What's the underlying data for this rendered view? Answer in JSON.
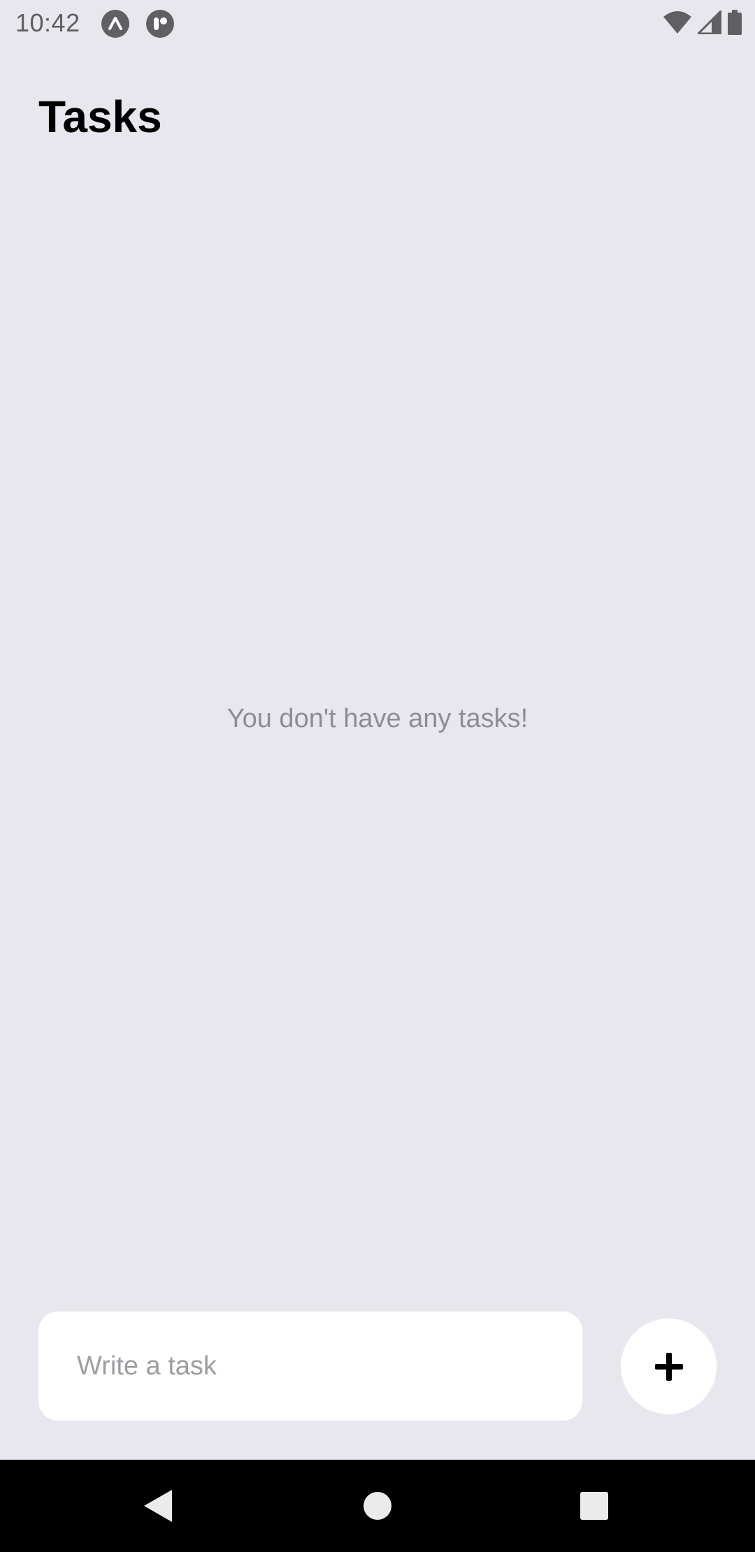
{
  "status_bar": {
    "time": "10:42",
    "icons": [
      "expo-icon",
      "expo-go-icon",
      "wifi-icon",
      "cellular-signal-icon",
      "battery-icon"
    ]
  },
  "header": {
    "title": "Tasks"
  },
  "empty_state": {
    "message": "You don't have any tasks!"
  },
  "composer": {
    "placeholder": "Write a task",
    "value": "",
    "add_button_icon": "plus-icon"
  },
  "nav_bar": {
    "icons": [
      "back-icon",
      "home-icon",
      "recents-icon"
    ]
  },
  "colors": {
    "background": "#E8E7ED",
    "surface": "#FFFFFF",
    "title": "#000000",
    "muted_text": "#8E8D93",
    "nav_bar": "#000000"
  }
}
